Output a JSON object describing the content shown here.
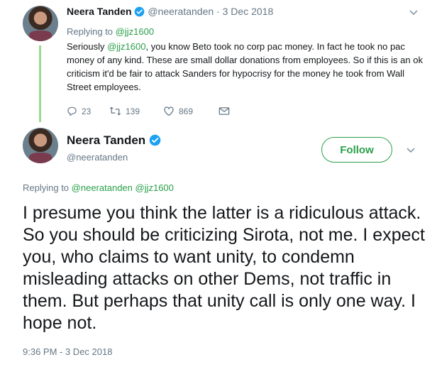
{
  "parent_tweet": {
    "author_name": "Neera Tanden",
    "handle": "@neeratanden",
    "separator": "·",
    "date": "3 Dec 2018",
    "replying_prefix": "Replying to",
    "replying_handle": "@jjz1600",
    "body_pre": "Seriously ",
    "body_mention": "@jjz1600",
    "body_post": ", you know Beto took no corp pac money. In fact he took no pac money of any kind. These are small dollar donations from employees. So if this is an ok criticism it'd be fair to attack Sanders for hypocrisy for the money he took from Wall Street employees.",
    "reply_count": "23",
    "retweet_count": "139",
    "like_count": "869"
  },
  "main_tweet": {
    "author_name": "Neera Tanden",
    "handle": "@neeratanden",
    "follow_label": "Follow",
    "replying_prefix": "Replying to",
    "replying_handles": "@neeratanden @jjz1600",
    "body": "I presume you think the latter is a ridiculous attack.  So you should be criticizing Sirota, not me.  I expect you, who claims to want unity, to condemn misleading attacks on other Dems, not traffic in them. But perhaps that unity call is only one way. I hope not.",
    "timestamp": "9:36 PM - 3 Dec 2018"
  },
  "colors": {
    "accent": "#2aa04a",
    "verified": "#1da1f2",
    "muted": "#657786",
    "thread_line": "#9fd98f"
  },
  "icons": [
    "verified-badge-icon",
    "chevron-down-icon",
    "reply-icon",
    "retweet-icon",
    "like-icon",
    "direct-message-icon"
  ]
}
